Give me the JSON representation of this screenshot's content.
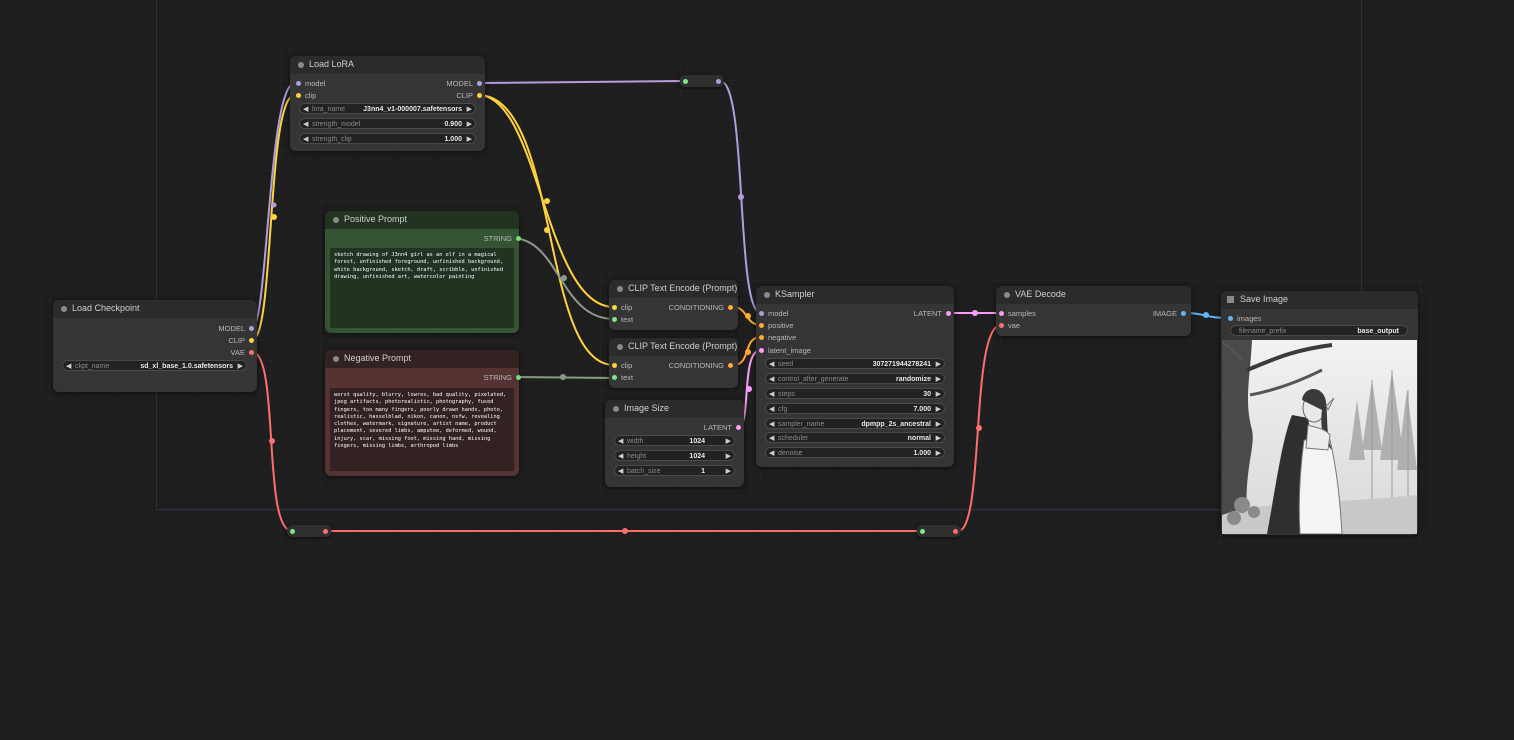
{
  "colors": {
    "model": "#b39ddb",
    "clip": "#ffd23f",
    "vae": "#ff6e6e",
    "conditioning": "#ffa931",
    "latent": "#ff9cf9",
    "image": "#64b5f6",
    "string": "#77dd77",
    "text": "#7ee787",
    "link_gray": "#8c9a8c"
  },
  "nodes": {
    "load_lora": {
      "title": "Load LoRA",
      "inputs": [
        "model",
        "clip"
      ],
      "outputs": [
        "MODEL",
        "CLIP"
      ],
      "widgets": [
        {
          "label": "lora_name",
          "value": "J3nn4_v1-000007.safetensors"
        },
        {
          "label": "strength_model",
          "value": "0.900"
        },
        {
          "label": "strength_clip",
          "value": "1.000"
        }
      ]
    },
    "load_checkpoint": {
      "title": "Load Checkpoint",
      "outputs": [
        "MODEL",
        "CLIP",
        "VAE"
      ],
      "widgets": [
        {
          "label": "ckpt_name",
          "value": "sd_xl_base_1.0.safetensors"
        }
      ]
    },
    "positive_prompt": {
      "title": "Positive Prompt",
      "output": "STRING",
      "text": "sketch drawing of J3nn4 girl as an elf in a magical forest, unfinished foreground, unfinished background, white background, sketch, draft, scribble, unfinished drawing, unfinished art, watercolor painting"
    },
    "negative_prompt": {
      "title": "Negative Prompt",
      "output": "STRING",
      "text": "worst quality, blurry, lowres, bad quality, pixelated, jpeg artifacts, photorealistic, photography, fused fingers, too many fingers, poorly drawn hands, photo, realistic, hasselblad, nikon, canon, nsfw, revealing clothes, watermark, signature, artist name, product placement, severed limbs, amputee, deformed, wound, injury, scar, missing foot, missing hand, missing fingers, missing limbs, arthropod limbs"
    },
    "clip_encode_pos": {
      "title": "CLIP Text Encode (Prompt)",
      "inputs": [
        "clip",
        "text"
      ],
      "output": "CONDITIONING"
    },
    "clip_encode_neg": {
      "title": "CLIP Text Encode (Prompt)",
      "inputs": [
        "clip",
        "text"
      ],
      "output": "CONDITIONING"
    },
    "image_size": {
      "title": "Image Size",
      "output": "LATENT",
      "widgets": [
        {
          "label": "width",
          "value": "1024"
        },
        {
          "label": "height",
          "value": "1024"
        },
        {
          "label": "batch_size",
          "value": "1"
        }
      ]
    },
    "ksampler": {
      "title": "KSampler",
      "inputs": [
        "model",
        "positive",
        "negative",
        "latent_image"
      ],
      "output": "LATENT",
      "widgets": [
        {
          "label": "seed",
          "value": "307271944278241"
        },
        {
          "label": "control_after_generate",
          "value": "randomize"
        },
        {
          "label": "steps",
          "value": "30"
        },
        {
          "label": "cfg",
          "value": "7.000"
        },
        {
          "label": "sampler_name",
          "value": "dpmpp_2s_ancestral"
        },
        {
          "label": "scheduler",
          "value": "normal"
        },
        {
          "label": "denoise",
          "value": "1.000"
        }
      ]
    },
    "vae_decode": {
      "title": "VAE Decode",
      "inputs": [
        "samples",
        "vae"
      ],
      "output": "IMAGE"
    },
    "save_image": {
      "title": "Save Image",
      "input": "images",
      "widgets": [
        {
          "label": "filename_prefix",
          "value": "base_output"
        }
      ]
    }
  }
}
